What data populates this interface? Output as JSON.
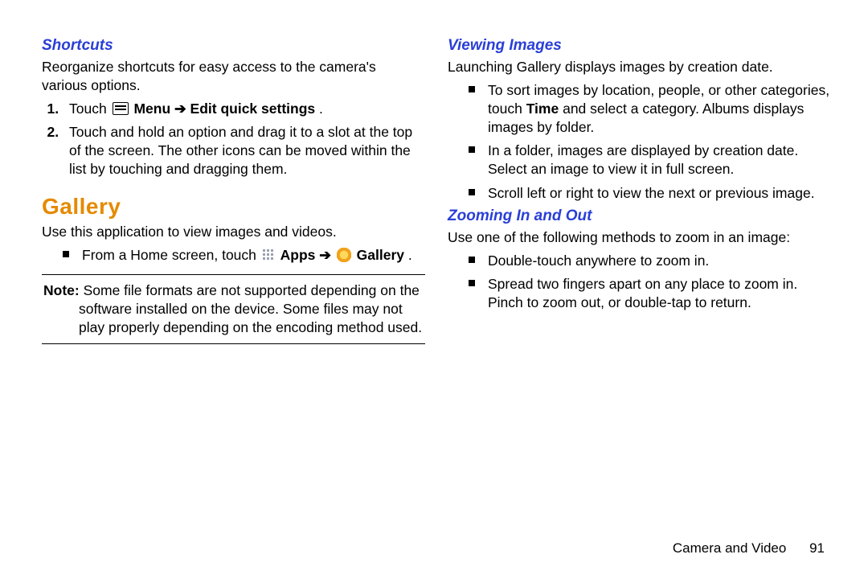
{
  "left": {
    "h_shortcuts": "Shortcuts",
    "p_shortcuts": "Reorganize shortcuts for easy access to the camera's various options.",
    "step1_pre": "Touch ",
    "step1_menu": "Menu",
    "step1_arrow": " ➔ ",
    "step1_post": "Edit quick settings",
    "step1_end": ".",
    "step2": "Touch and hold an option and drag it to a slot at the top of the screen. The other icons can be moved within the list by touching and dragging them.",
    "h_gallery": "Gallery",
    "p_gallery": "Use this application to view images and videos.",
    "bullet_pre": "From a Home screen, touch ",
    "bullet_apps": "Apps",
    "bullet_arrow": " ➔ ",
    "bullet_gallery": "Gallery",
    "bullet_end": ".",
    "note_label": "Note:",
    "note_first": " Some file formats are not supported depending on the",
    "note_rest": "software installed on the device. Some files may not play properly depending on the encoding method used."
  },
  "right": {
    "h_viewing": "Viewing Images",
    "p_viewing": "Launching Gallery displays images by creation date.",
    "v1_pre": "To sort images by location, people, or other categories, touch ",
    "v1_bold": "Time",
    "v1_post": " and select a category. Albums displays images by folder.",
    "v2": "In a folder, images are displayed by creation date. Select an image to view it in full screen.",
    "v3": "Scroll left or right to view the next or previous image.",
    "h_zoom": "Zooming In and Out",
    "p_zoom": "Use one of the following methods to zoom in an image:",
    "z1": "Double-touch anywhere to zoom in.",
    "z2": "Spread two fingers apart on any place to zoom in. Pinch to zoom out, or double-tap to return."
  },
  "footer": {
    "section": "Camera and Video",
    "page": "91"
  }
}
